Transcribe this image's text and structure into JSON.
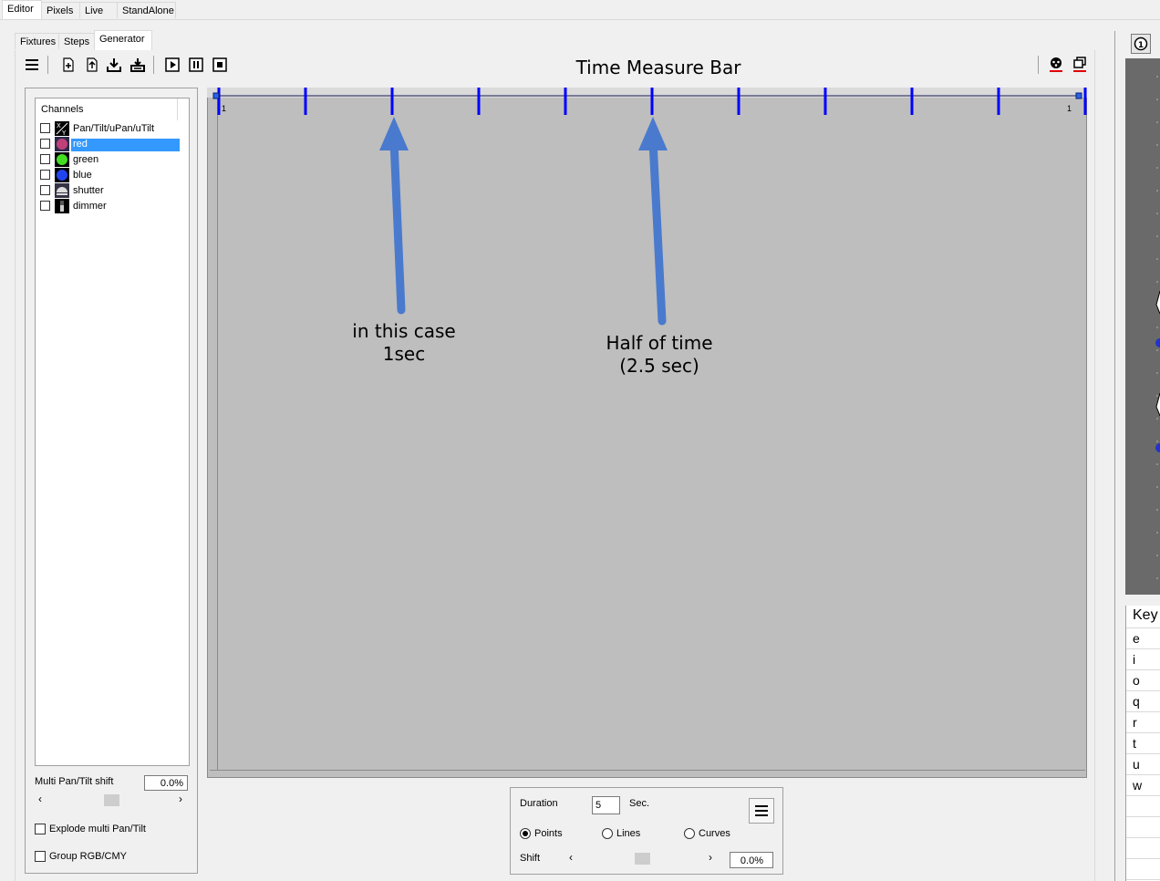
{
  "main_tabs": [
    "Editor",
    "Pixels",
    "Live",
    "StandAlone"
  ],
  "sub_tabs": [
    "Fixtures",
    "Steps",
    "Generator"
  ],
  "toolbar": {
    "title": "Time Measure Bar",
    "menu_icon": "hamburger-icon",
    "buttons": [
      "new-icon",
      "open-icon",
      "import-icon",
      "export-icon",
      "play-icon",
      "pause-icon",
      "stop-icon"
    ]
  },
  "channels": {
    "header": "Channels",
    "items": [
      {
        "label": "Pan/Tilt/uPan/uTilt",
        "icon": "xy-icon",
        "selected": false
      },
      {
        "label": "red",
        "icon": "red-color-icon",
        "selected": true
      },
      {
        "label": "green",
        "icon": "green-color-icon",
        "selected": false
      },
      {
        "label": "blue",
        "icon": "blue-color-icon",
        "selected": false
      },
      {
        "label": "shutter",
        "icon": "shutter-icon",
        "selected": false
      },
      {
        "label": "dimmer",
        "icon": "dimmer-icon",
        "selected": false
      }
    ]
  },
  "left_options": {
    "multi_shift_label": "Multi Pan/Tilt shift",
    "multi_shift_value": "0.0%",
    "explode_label": "Explode multi Pan/Tilt",
    "group_label": "Group RGB/CMY"
  },
  "timeline": {
    "start_label": "1",
    "end_label": "1",
    "tick_count": 11,
    "accent_color": "#0000ff"
  },
  "annotations": {
    "left_line1": "in this case",
    "left_line2": "1sec",
    "right_line1": "Half of time",
    "right_line2": "(2.5 sec)",
    "arrow_color": "#4a7acd"
  },
  "bottom_panel": {
    "duration_label": "Duration",
    "duration_value": "5",
    "duration_unit": "Sec.",
    "modes": [
      {
        "label": "Points",
        "selected": true
      },
      {
        "label": "Lines",
        "selected": false
      },
      {
        "label": "Curves",
        "selected": false
      }
    ],
    "shift_label": "Shift",
    "shift_value": "0.0%"
  },
  "right_panel": {
    "info_icon": "1",
    "key_header": "Key",
    "keys": [
      "e",
      "i",
      "o",
      "q",
      "r",
      "t",
      "u",
      "w"
    ]
  }
}
